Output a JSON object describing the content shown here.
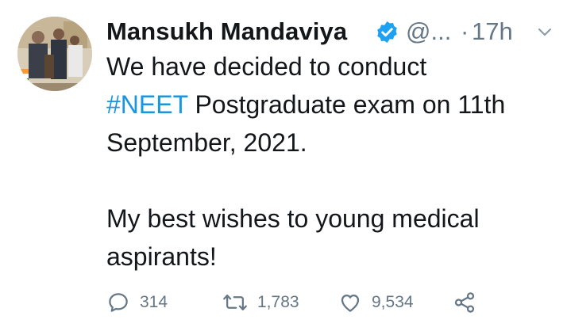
{
  "tweet": {
    "author_name": "Mansukh Mandaviya",
    "handle": "@...",
    "separator": "·",
    "time": "17h",
    "text": {
      "line1": "We have decided to conduct",
      "hashtag": "#NEET",
      "line2_rest": " Postgraduate exam on 11th",
      "line3": "September, 2021.",
      "para2": "My best wishes to young medical aspirants!"
    },
    "actions": {
      "replies": "314",
      "retweets": "1,783",
      "likes": "9,534"
    }
  },
  "colors": {
    "text": "#14171a",
    "secondary": "#657786",
    "link": "#1b95e0",
    "verified": "#1da1f2"
  },
  "icons": [
    "verified-badge-icon",
    "chevron-down-icon",
    "reply-icon",
    "retweet-icon",
    "like-icon",
    "share-icon"
  ]
}
